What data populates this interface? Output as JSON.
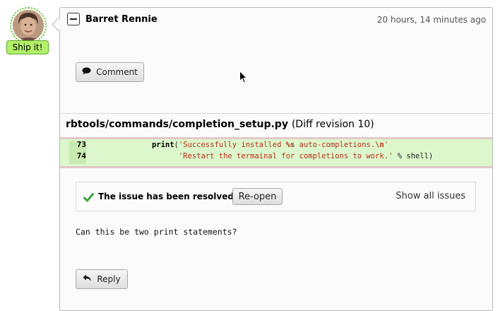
{
  "review": {
    "badge": "Ship it!",
    "author": "Barret Rennie",
    "timestamp": "20 hours, 14 minutes ago",
    "comment_button": "Comment"
  },
  "diff": {
    "file_path": "rbtools/commands/completion_setup.py",
    "revision": "(Diff revision 10)",
    "lines": [
      {
        "number": "73",
        "indent": "      ",
        "keyword": "print",
        "open": "(",
        "str_a": "'Successfully installed ",
        "esc_a": "%s",
        "str_b": " auto-completions.",
        "esc_b": "\\n",
        "str_c": "'",
        "tail": ""
      },
      {
        "number": "74",
        "indent": "            ",
        "keyword": "",
        "open": "",
        "str_a": "'Restart the termainal for completions to work.'",
        "esc_a": "",
        "str_b": "",
        "esc_b": "",
        "str_c": "",
        "tail": " % shell)"
      }
    ]
  },
  "issue": {
    "status_text": "The issue has been resolved.",
    "reopen_button": "Re-open",
    "show_all": "Show all issues",
    "status_color": "#3ca63c"
  },
  "comment": {
    "text": "Can this be two print statements?",
    "reply_button": "Reply"
  }
}
